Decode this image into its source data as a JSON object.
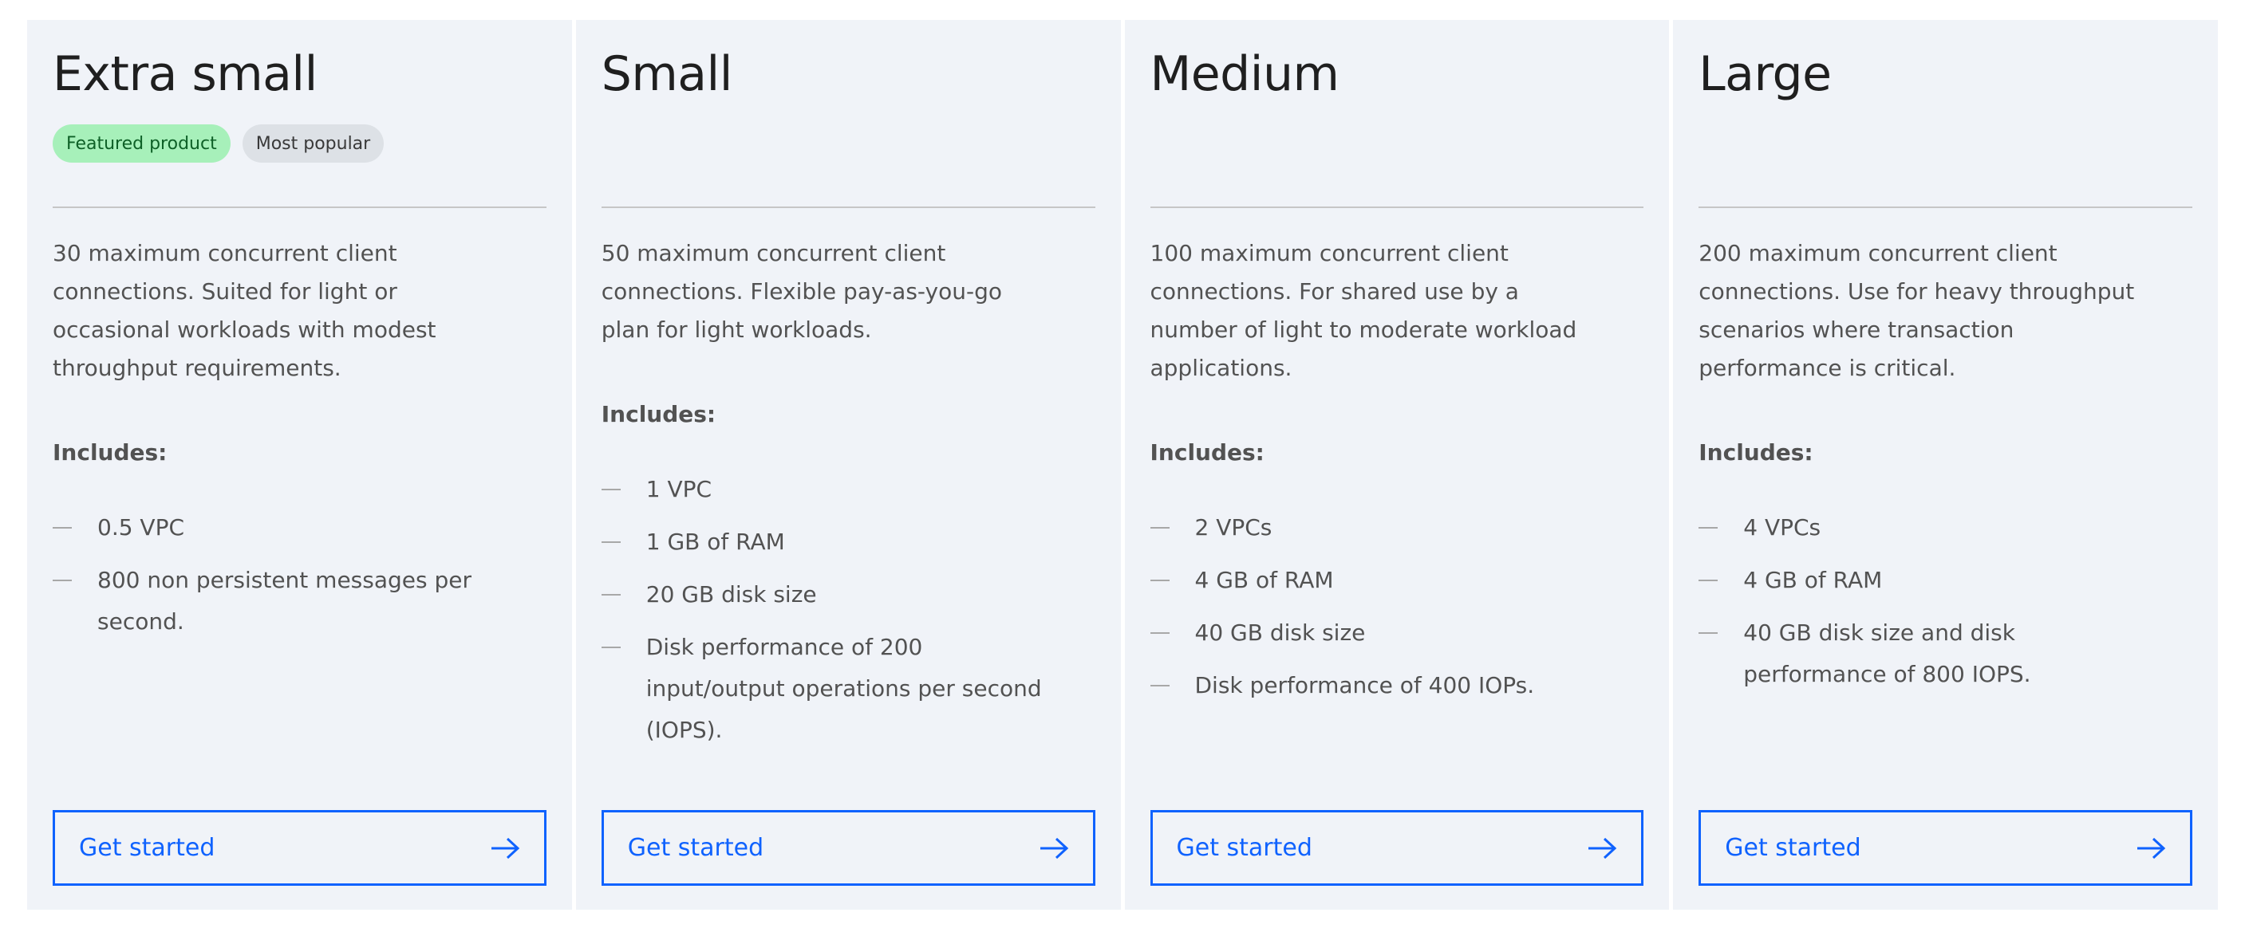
{
  "colors": {
    "card_background": "#f0f3f8",
    "accent": "#0f62fe",
    "featured_tag_background": "#a7f0ba",
    "featured_tag_text": "#0e6027",
    "popular_tag_background": "#dde1e6",
    "body_text": "#525252",
    "title_text": "#1f1f1f"
  },
  "plans": [
    {
      "name": "Extra small",
      "tags": [
        "Featured product",
        "Most popular"
      ],
      "description": "30 maximum concurrent client connections. Suited for light or occasional workloads with modest throughput requirements.",
      "includes_label": "Includes:",
      "features": [
        "0.5 VPC",
        "800 non persistent messages per second."
      ],
      "cta_label": "Get started",
      "cta_icon": "arrow-right-icon"
    },
    {
      "name": "Small",
      "tags": [],
      "description": "50 maximum concurrent client connections. Flexible pay-as-you-go plan for light workloads.",
      "includes_label": "Includes:",
      "features": [
        "1 VPC",
        "1 GB of RAM",
        "20 GB disk size",
        "Disk performance of 200 input/output operations per second (IOPS)."
      ],
      "cta_label": "Get started",
      "cta_icon": "arrow-right-icon"
    },
    {
      "name": "Medium",
      "tags": [],
      "description": "100 maximum concurrent client connections. For shared use by a number of light to moderate workload applications.",
      "includes_label": "Includes:",
      "features": [
        "2 VPCs",
        "4 GB of RAM",
        "40 GB disk size",
        "Disk performance of 400 IOPs."
      ],
      "cta_label": "Get started",
      "cta_icon": "arrow-right-icon"
    },
    {
      "name": "Large",
      "tags": [],
      "description": "200 maximum concurrent client connections. Use for heavy throughput scenarios where transaction performance is critical.",
      "includes_label": "Includes:",
      "features": [
        "4 VPCs",
        "4 GB of RAM",
        "40 GB disk size and disk performance of 800 IOPS."
      ],
      "cta_label": "Get started",
      "cta_icon": "arrow-right-icon"
    }
  ]
}
